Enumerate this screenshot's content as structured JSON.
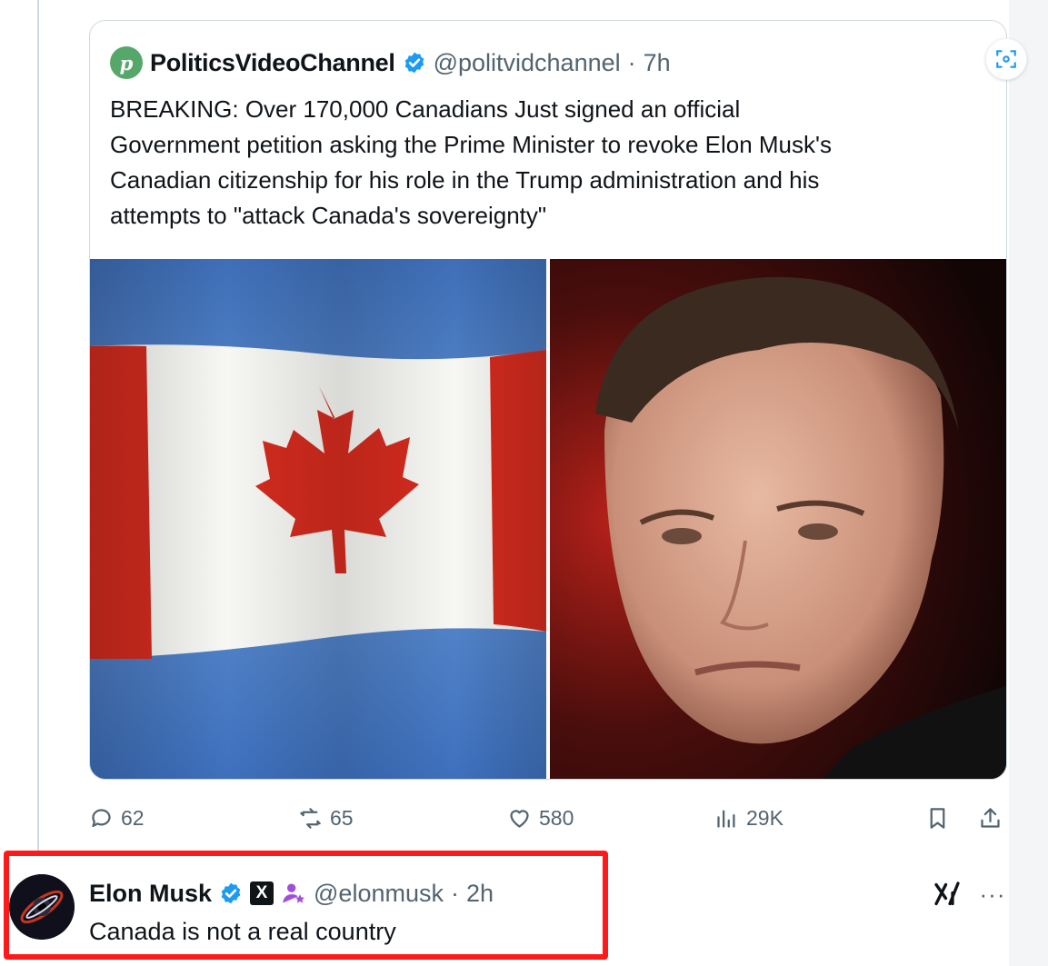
{
  "quoted_post": {
    "avatar_letter": "p",
    "display_name": "PoliticsVideoChannel",
    "handle": "@politvidchannel",
    "separator": "·",
    "time": "7h",
    "text": "BREAKING: Over 170,000 Canadians Just signed an official\nGovernment petition asking the Prime Minister to revoke Elon Musk's\nCanadian citizenship for his role in the Trump administration and his\nattempts to \"attack Canada's sovereignty\"",
    "images": [
      "canadian-flag-photo",
      "elon-musk-portrait-photo"
    ],
    "media_button_icon": "grok-image-icon"
  },
  "actions": {
    "replies": "62",
    "reposts": "65",
    "likes": "580",
    "views": "29K",
    "icons": [
      "reply-icon",
      "repost-icon",
      "like-icon",
      "views-icon",
      "bookmark-icon",
      "share-icon"
    ]
  },
  "reply_post": {
    "display_name": "Elon Musk",
    "x_badge": "X",
    "handle": "@elonmusk",
    "separator": "·",
    "time": "2h",
    "text": "Canada is not a real country",
    "more": "···"
  },
  "colors": {
    "highlight": "#ff1a1a",
    "verified": "#1d9bf0",
    "secondary_text": "#536471",
    "flag_red": "#d52b1e",
    "sky_blue": "#4a7fc8"
  }
}
